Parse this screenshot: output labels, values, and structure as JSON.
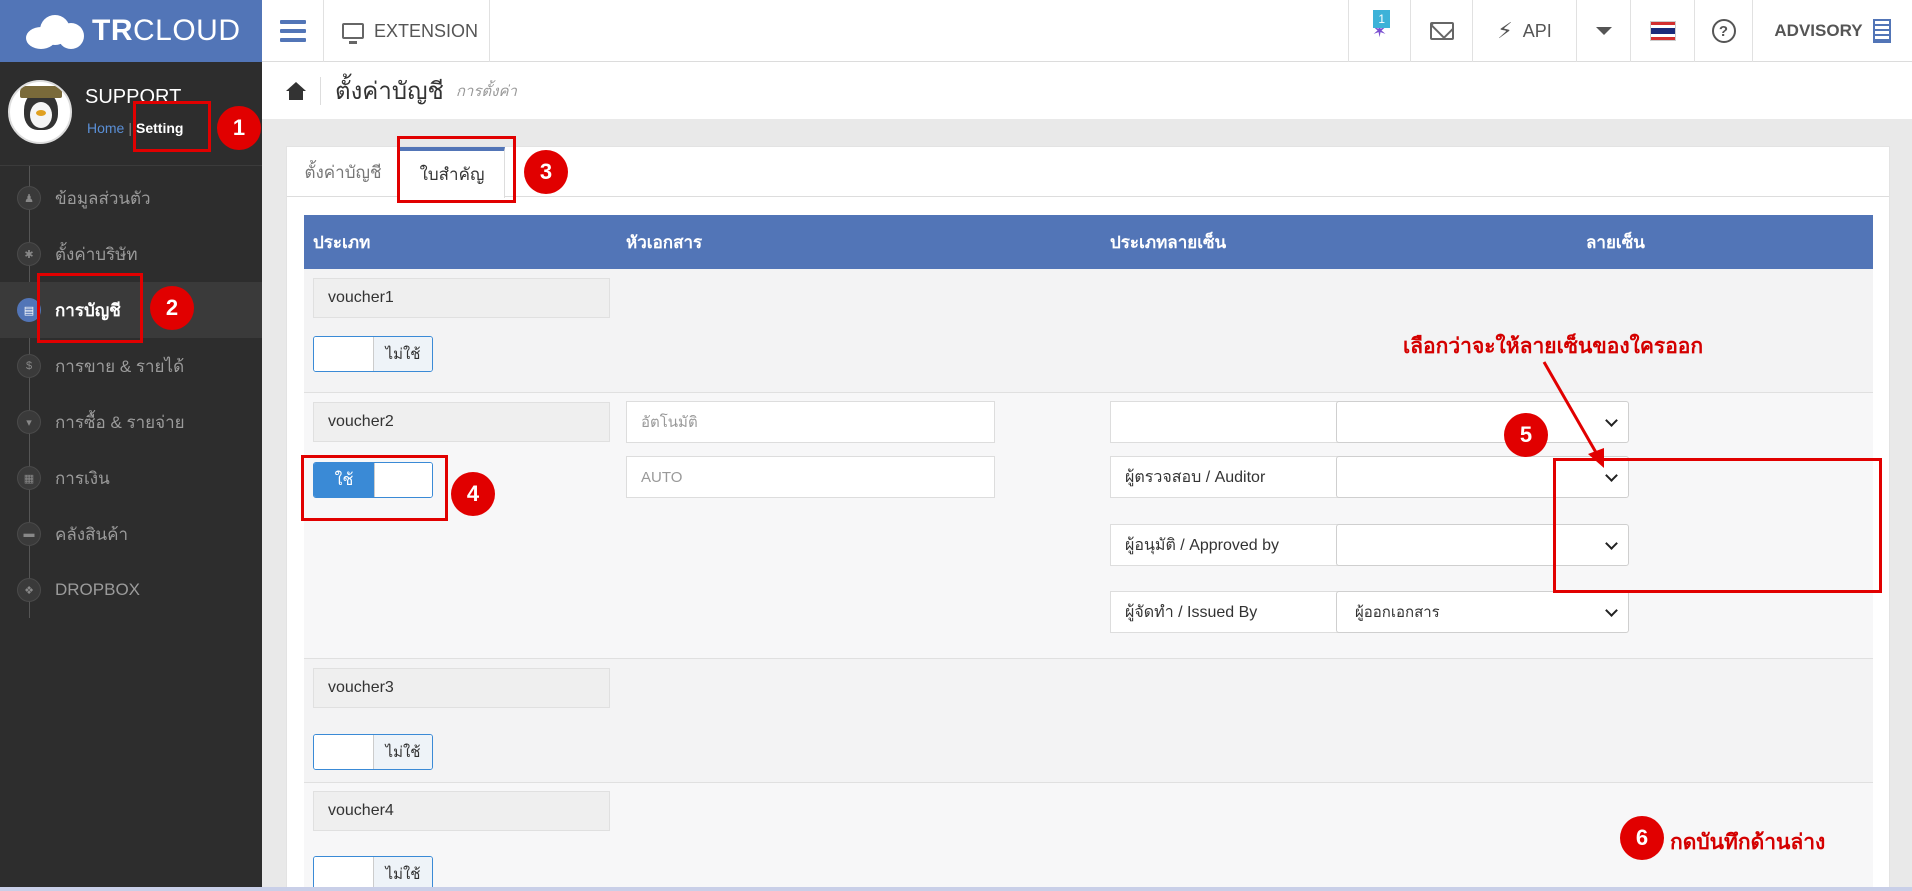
{
  "topbar": {
    "brand_bold": "TR",
    "brand_rest": "CLOUD",
    "extension_label": "EXTENSION",
    "notification_count": "1",
    "api_label": "API",
    "advisory_label": "ADVISORY"
  },
  "sidebar": {
    "profile_name": "SUPPORT",
    "home_link": "Home",
    "separator": "|",
    "setting_link": "Setting",
    "items": [
      {
        "label": "ข้อมูลส่วนตัว",
        "icon": "user-icon",
        "glyph": "♟"
      },
      {
        "label": "ตั้งค่าบริษัท",
        "icon": "gear-icon",
        "glyph": "✱"
      },
      {
        "label": "การบัญชี",
        "icon": "book-icon",
        "glyph": "▤"
      },
      {
        "label": "การขาย & รายได้",
        "icon": "dollar-icon",
        "glyph": "$"
      },
      {
        "label": "การซื้อ & รายจ่าย",
        "icon": "cart-icon",
        "glyph": "▾"
      },
      {
        "label": "การเงิน",
        "icon": "calendar-icon",
        "glyph": "▦"
      },
      {
        "label": "คลังสินค้า",
        "icon": "truck-icon",
        "glyph": "▬"
      },
      {
        "label": "DROPBOX",
        "icon": "dropbox-icon",
        "glyph": "❖"
      }
    ]
  },
  "breadcrumb": {
    "title": "ตั้งค่าบัญชี",
    "subtitle": "การตั้งค่า"
  },
  "tabs": [
    "ตั้งค่าบัญชี",
    "ใบสำคัญ"
  ],
  "table": {
    "headers": [
      "ประเภท",
      "หัวเอกสาร",
      "ประเภทลายเซ็น",
      "ลายเซ็น"
    ],
    "voucher1": {
      "name": "voucher1",
      "toggle": "ไม่ใช้"
    },
    "voucher2": {
      "name": "voucher2",
      "toggle": "ใช้",
      "header_auto": "อัตโนมัติ",
      "header_value": "AUTO",
      "sig_type_blank": "",
      "sig_types": [
        "ผู้ตรวจสอบ / Auditor",
        "ผู้อนุมัติ / Approved by",
        "ผู้จัดทำ / Issued By"
      ],
      "sig_values": [
        "",
        "",
        "",
        "ผู้ออกเอกสาร"
      ]
    },
    "voucher3": {
      "name": "voucher3",
      "toggle": "ไม่ใช้"
    },
    "voucher4": {
      "name": "voucher4",
      "toggle": "ไม่ใช้"
    }
  },
  "annotations": {
    "steps": [
      "1",
      "2",
      "3",
      "4",
      "5",
      "6"
    ],
    "note_signature": "เลือกว่าจะให้ลายเซ็นของใครออก",
    "note_save": "กดบันทึกด้านล่าง",
    "color": "#e10000"
  },
  "colors": {
    "brand": "#5275b7",
    "sidebar": "#2d2d2d",
    "toggle_on": "#3a8ad6"
  }
}
